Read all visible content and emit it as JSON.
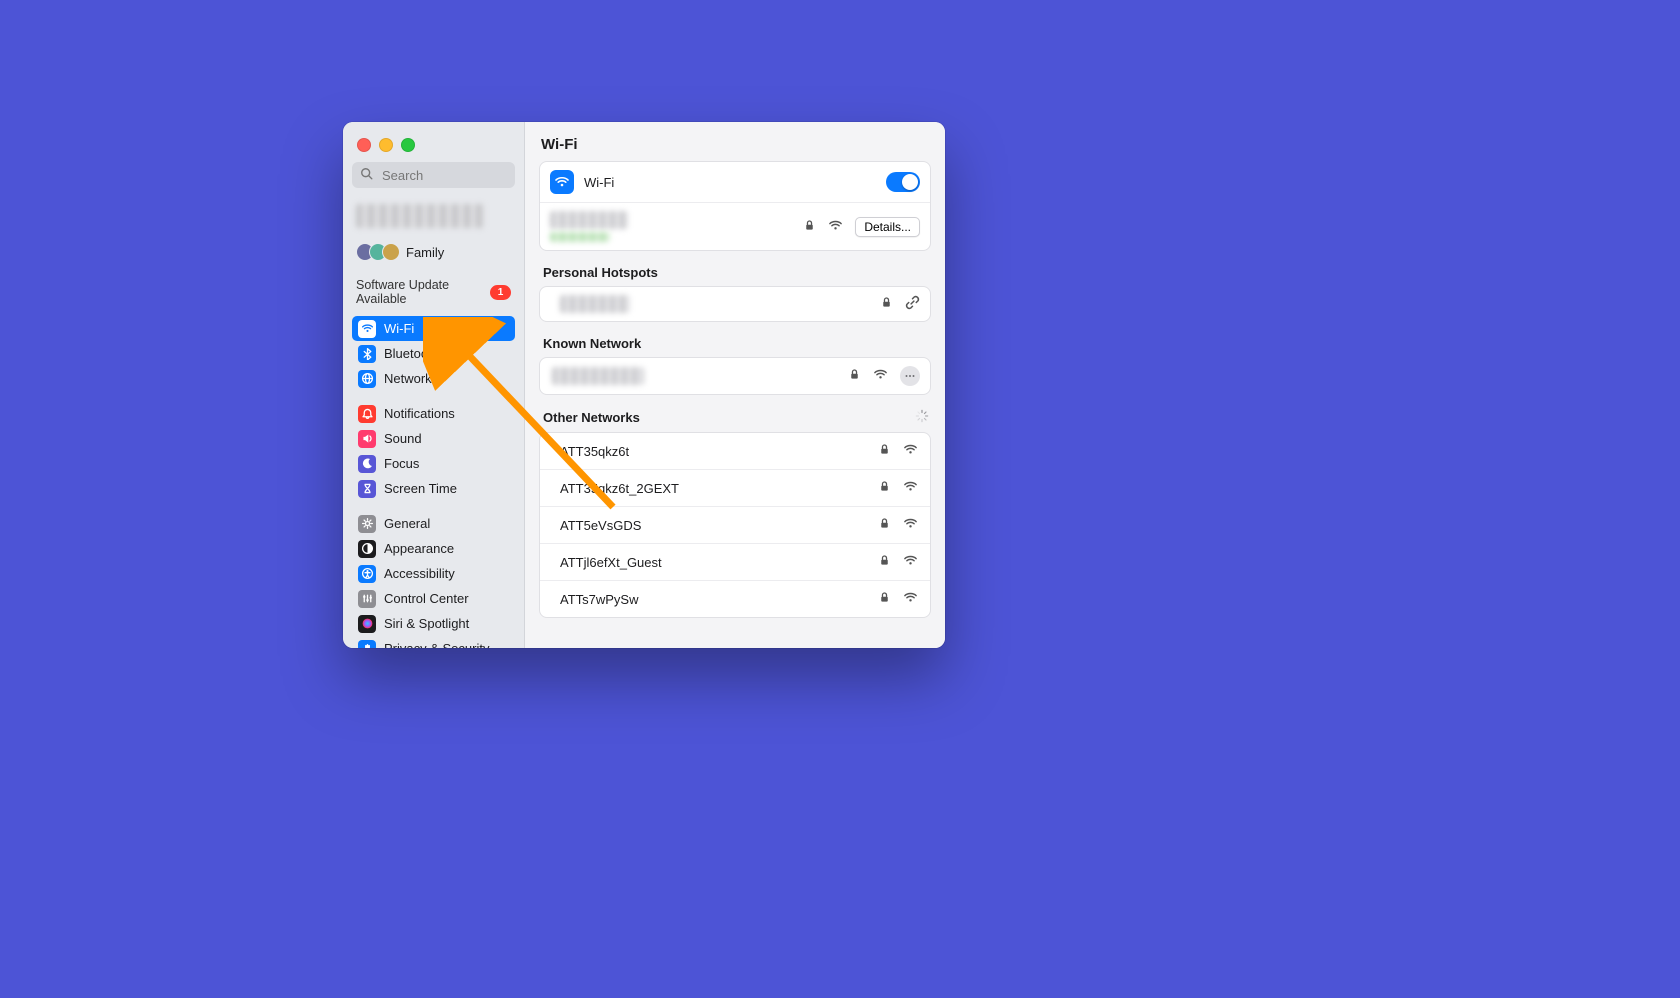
{
  "window": {
    "title": "Wi-Fi"
  },
  "search": {
    "placeholder": "Search"
  },
  "sidebar": {
    "family_label": "Family",
    "update_label": "Software Update Available",
    "update_badge": "1",
    "groups": [
      {
        "items": [
          {
            "id": "wifi",
            "label": "Wi-Fi",
            "icon": "wifi-icon",
            "color": "#0a7aff",
            "selected": true
          },
          {
            "id": "bluetooth",
            "label": "Bluetooth",
            "icon": "bluetooth-icon",
            "color": "#0a7aff"
          },
          {
            "id": "network",
            "label": "Network",
            "icon": "globe-icon",
            "color": "#0a7aff"
          }
        ]
      },
      {
        "items": [
          {
            "id": "notifications",
            "label": "Notifications",
            "icon": "bell-icon",
            "color": "#ff3b30"
          },
          {
            "id": "sound",
            "label": "Sound",
            "icon": "speaker-icon",
            "color": "#ff3b6e"
          },
          {
            "id": "focus",
            "label": "Focus",
            "icon": "moon-icon",
            "color": "#5856d6"
          },
          {
            "id": "screentime",
            "label": "Screen Time",
            "icon": "hourglass-icon",
            "color": "#5856d6"
          }
        ]
      },
      {
        "items": [
          {
            "id": "general",
            "label": "General",
            "icon": "gear-icon",
            "color": "#8e8e93"
          },
          {
            "id": "appearance",
            "label": "Appearance",
            "icon": "appearance-icon",
            "color": "#1c1c1e"
          },
          {
            "id": "accessibility",
            "label": "Accessibility",
            "icon": "accessibility-icon",
            "color": "#0a7aff"
          },
          {
            "id": "controlcenter",
            "label": "Control Center",
            "icon": "controls-icon",
            "color": "#8e8e93"
          },
          {
            "id": "siri",
            "label": "Siri & Spotlight",
            "icon": "siri-icon",
            "color": "#1c1c1e"
          },
          {
            "id": "privacy",
            "label": "Privacy & Security",
            "icon": "hand-icon",
            "color": "#0a7aff"
          }
        ]
      }
    ]
  },
  "wifi": {
    "header_label": "Wi-Fi",
    "toggle_on": true,
    "details_button": "Details...",
    "sections": {
      "hotspots_title": "Personal Hotspots",
      "known_title": "Known Network",
      "other_title": "Other Networks"
    },
    "other_networks": [
      {
        "name": "ATT35qkz6t",
        "locked": true
      },
      {
        "name": "ATT35qkz6t_2GEXT",
        "locked": true
      },
      {
        "name": "ATT5eVsGDS",
        "locked": true
      },
      {
        "name": "ATTjl6efXt_Guest",
        "locked": true
      },
      {
        "name": "ATTs7wPySw",
        "locked": true
      }
    ]
  }
}
